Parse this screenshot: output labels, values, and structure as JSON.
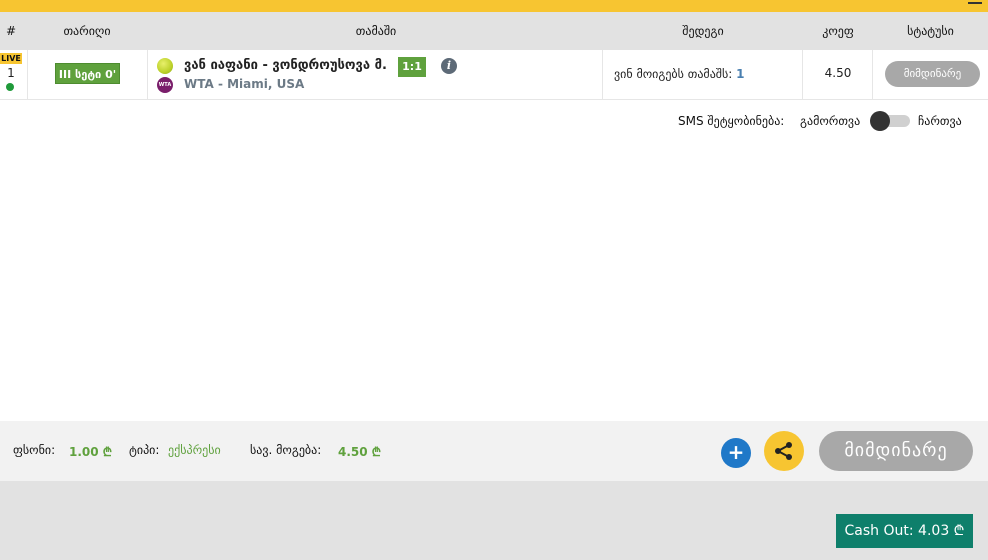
{
  "table": {
    "headers": {
      "num": "#",
      "date": "თარიღი",
      "game": "თამაში",
      "outcome": "შედეგი",
      "coef": "კოეფ",
      "status": "სტატუსი"
    }
  },
  "bet": {
    "live_badge": "LIVE",
    "row_number": "1",
    "set_time": "III სეტი 0'",
    "sport_icon": "tennis-ball-icon",
    "league_icon": "wta-logo-icon",
    "league_icon_text": "WTA",
    "match": "ვან იაფანი - ვონდროუსოვა მ.",
    "score": "1:1",
    "league": "WTA - Miami, USA",
    "outcome_label": "ვინ მოიგებს თამაშს:",
    "outcome_pick": "1",
    "coef": "4.50",
    "status": "მიმდინარე"
  },
  "sms": {
    "label": "SMS შეტყობინება:",
    "off_label": "გამორთვა",
    "on_label": "ჩართვა",
    "enabled": false
  },
  "footer": {
    "stake_label": "ფსონი:",
    "stake_value": "1.00 ₾",
    "type_label": "ტიპი:",
    "type_value": "ექსპრესი",
    "win_label": "სავ. მოგება:",
    "win_value": "4.50 ₾",
    "add_button": "+",
    "share_icon": "share-icon",
    "status_button": "მიმდინარე"
  },
  "cashout": {
    "label": "Cash Out: 4.03 ₾"
  },
  "colors": {
    "accent_yellow": "#f7c531",
    "green": "#5fa13d",
    "cashout": "#0e7f6b",
    "blue": "#1f78c8"
  }
}
